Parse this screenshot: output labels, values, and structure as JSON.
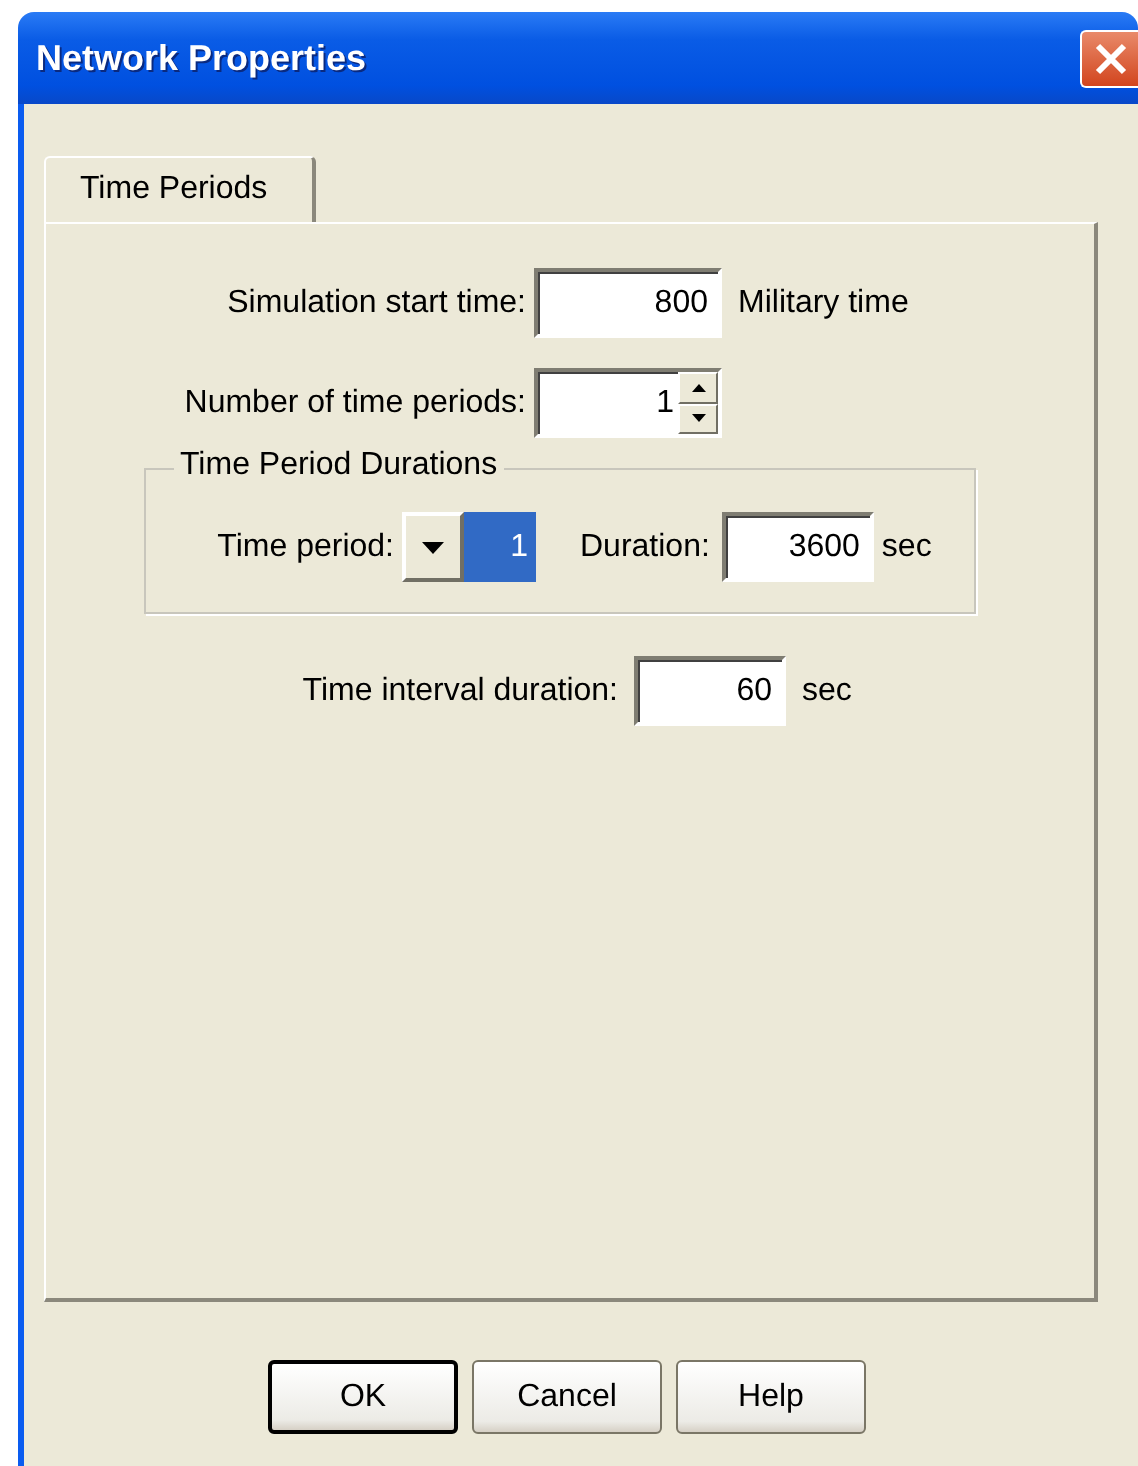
{
  "window": {
    "title": "Network Properties"
  },
  "tabs": [
    {
      "label": "Time Periods",
      "selected": true
    }
  ],
  "fields": [
    {
      "kind": "text",
      "label": "Simulation start time:",
      "value": "800",
      "unit": "Military time"
    },
    {
      "kind": "spin",
      "label": "Number of time periods:",
      "value": "1"
    }
  ],
  "group": {
    "title": "Time Period Durations",
    "time_period": {
      "label": "Time period:",
      "value": "1",
      "selected": true
    },
    "duration": {
      "label": "Duration:",
      "value": "3600",
      "unit": "sec"
    }
  },
  "interval": {
    "label": "Time interval duration:",
    "value": "60",
    "unit": "sec"
  },
  "buttons": [
    {
      "label": "OK",
      "default": true
    },
    {
      "label": "Cancel",
      "default": false
    },
    {
      "label": "Help",
      "default": false
    }
  ]
}
